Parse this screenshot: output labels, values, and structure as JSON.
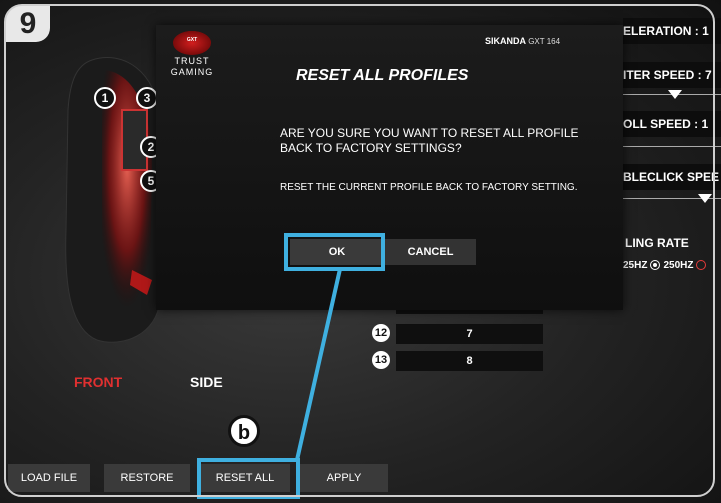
{
  "step_badge": "9",
  "mouse_buttons": [
    "1",
    "3",
    "2",
    "5"
  ],
  "view_tabs": {
    "front": "FRONT",
    "side": "SIDE"
  },
  "settings": {
    "acceleration": "ELERATION : 1",
    "pointer_speed": "ITER SPEED : 7",
    "scroll_speed": "OLL SPEED : 1",
    "doubleclick_speed": "BLECLICK SPEE",
    "polling_rate": "LING RATE",
    "polling_opt_1": "25HZ",
    "polling_opt_2": "250HZ"
  },
  "button_rows": [
    {
      "num": "12",
      "value": "7"
    },
    {
      "num": "13",
      "value": "8"
    }
  ],
  "dialog": {
    "brand_logo_text": "GXT",
    "brand_line1": "TRUST",
    "brand_line2": "GAMING",
    "model_name": "SIKANDA",
    "model_code": "GXT 164",
    "title": "RESET ALL PROFILES",
    "question": "ARE YOU SURE YOU WANT TO RESET ALL PROFILE BACK TO FACTORY SETTINGS?",
    "sub": "RESET THE CURRENT PROFILE BACK TO FACTORY SETTING.",
    "ok_label": "OK",
    "cancel_label": "CANCEL"
  },
  "bottom": {
    "load_file": "LOAD FILE",
    "restore": "RESTORE",
    "reset_all": "RESET ALL",
    "apply": "APPLY"
  },
  "callout_letter": "b",
  "colors": {
    "accent": "#3fb0e0",
    "front_tab": "#e03030"
  }
}
